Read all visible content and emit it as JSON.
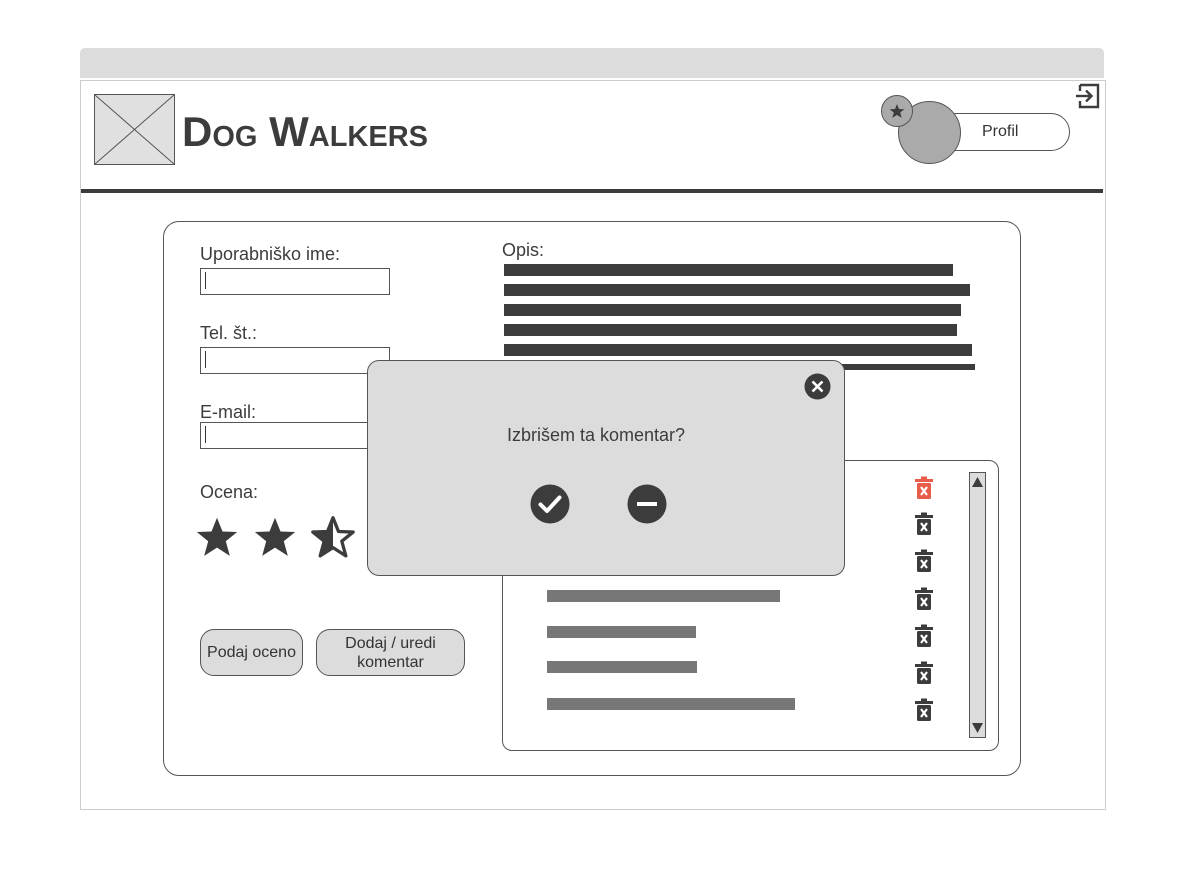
{
  "header": {
    "app_title": "Dog Walkers",
    "profile_label": "Profil"
  },
  "form": {
    "username_label": "Uporabniško ime:",
    "username_value": "",
    "phone_label": "Tel. št.:",
    "phone_value": "",
    "email_label": "E-mail:",
    "email_value": "",
    "rating_label": "Ocena:",
    "rating": {
      "value": 2.5,
      "max": 3
    },
    "rate_button": "Podaj oceno",
    "comment_button": "Dodaj / uredi komentar"
  },
  "description": {
    "label": "Opis:"
  },
  "comments": {
    "count": 7,
    "highlighted_delete_index": 0
  },
  "dialog": {
    "message": "Izbrišem ta komentar?",
    "confirm_icon": "check-circle-icon",
    "cancel_icon": "minus-circle-icon"
  },
  "colors": {
    "dark": "#3c3c3c",
    "panel": "#dcdcdc",
    "danger": "#e85c4a"
  }
}
